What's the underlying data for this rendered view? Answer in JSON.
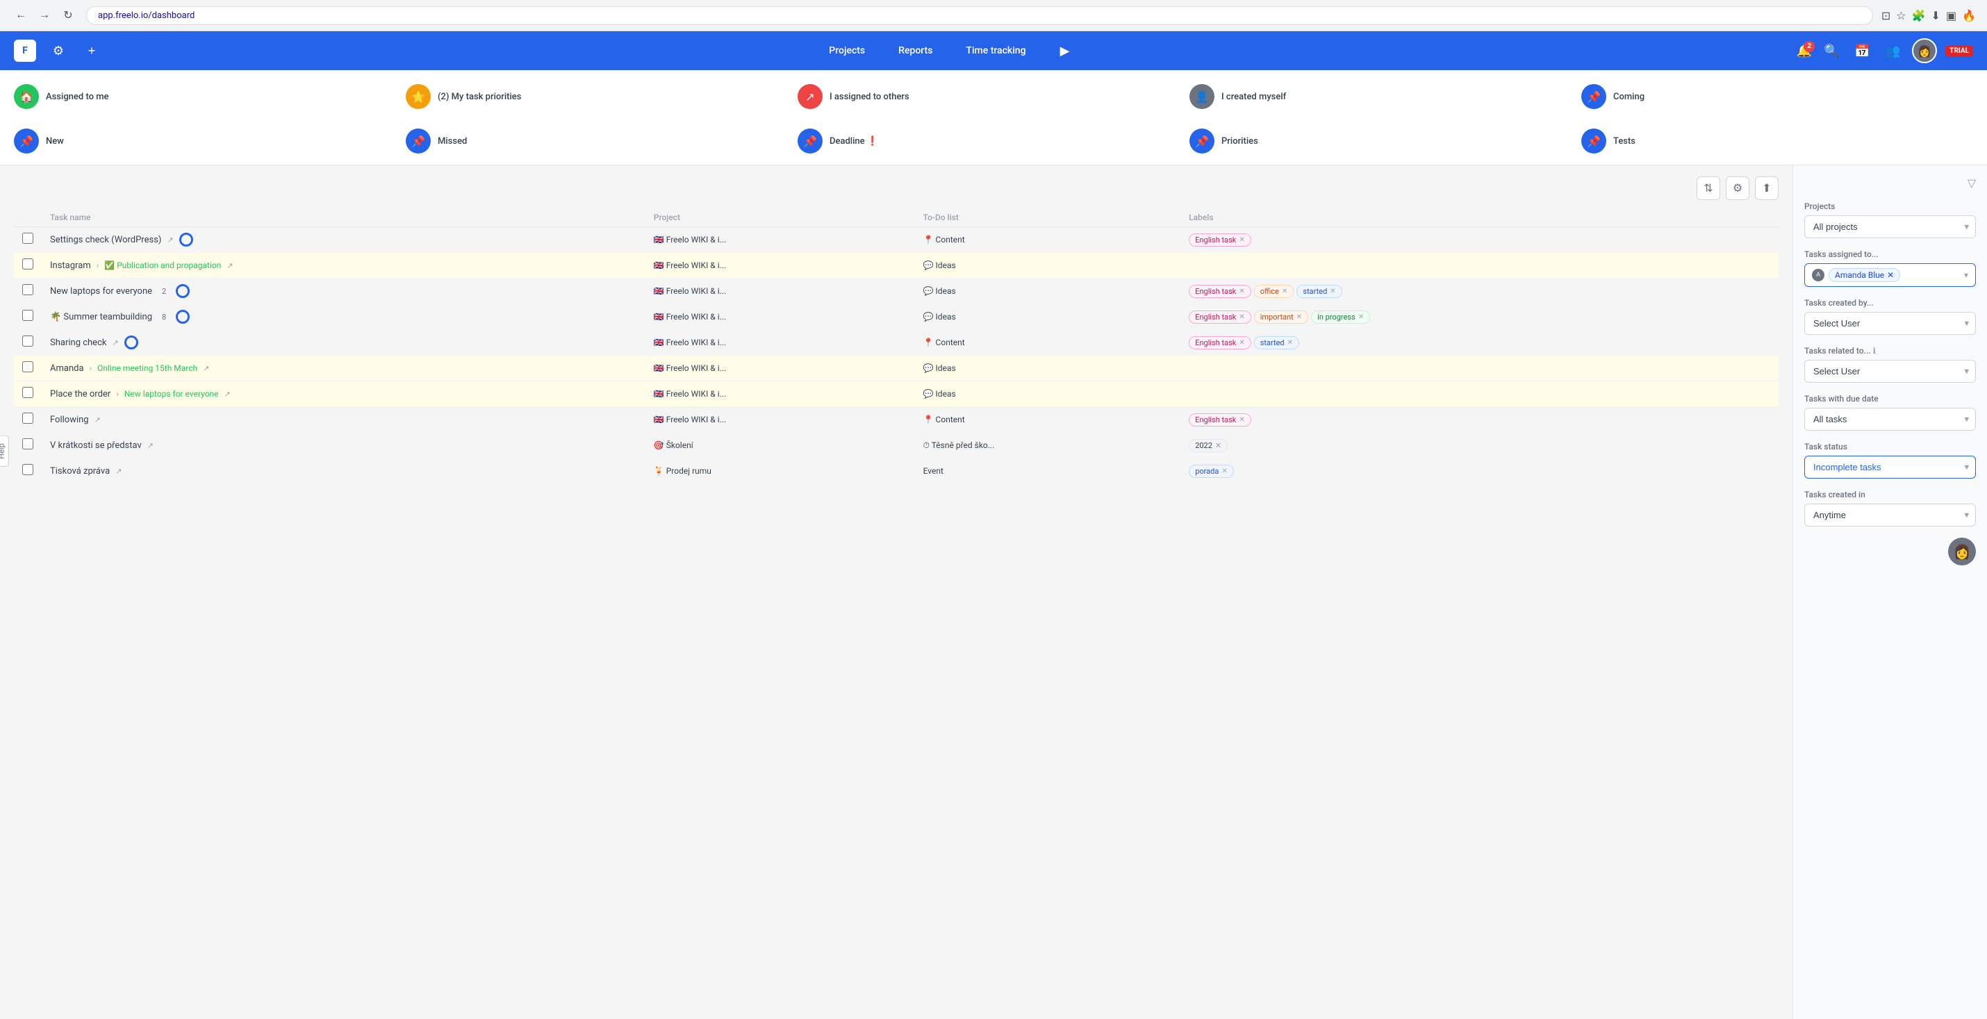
{
  "browser": {
    "url": "app.freelo.io/dashboard"
  },
  "header": {
    "logo_text": "F",
    "nav_items": [
      "Projects",
      "Reports",
      "Time tracking"
    ],
    "play_label": "▶",
    "notification_count": "2",
    "trial_label": "TRIAL"
  },
  "quick_filters": {
    "row1": [
      {
        "id": "assigned_to_me",
        "label": "Assigned to me",
        "icon": "🏠",
        "icon_bg": "#22c55e",
        "count": null
      },
      {
        "id": "my_task_priorities",
        "label": "My task priorities",
        "icon": "⭐",
        "icon_bg": "#f59e0b",
        "count": "2"
      },
      {
        "id": "assigned_to_others",
        "label": "I assigned to others",
        "icon": "↗",
        "icon_bg": "#ef4444",
        "count": null
      },
      {
        "id": "created_myself",
        "label": "I created myself",
        "icon": "👤",
        "icon_bg": "#6b7280",
        "count": null
      },
      {
        "id": "coming",
        "label": "Coming",
        "icon": "📌",
        "icon_bg": "#2563eb",
        "count": null
      }
    ],
    "row2": [
      {
        "id": "new",
        "label": "New",
        "icon": "📌",
        "icon_bg": "#2563eb"
      },
      {
        "id": "missed",
        "label": "Missed",
        "icon": "📌",
        "icon_bg": "#2563eb"
      },
      {
        "id": "deadline",
        "label": "Deadline ❗",
        "icon": "📌",
        "icon_bg": "#2563eb"
      },
      {
        "id": "priorities",
        "label": "Priorities",
        "icon": "📌",
        "icon_bg": "#2563eb"
      },
      {
        "id": "tests",
        "label": "Tests",
        "icon": "📌",
        "icon_bg": "#2563eb"
      }
    ]
  },
  "task_table": {
    "columns": [
      "Task name",
      "Project",
      "To-Do list",
      "Labels"
    ],
    "rows": [
      {
        "id": "row1",
        "name": "Settings check (WordPress)",
        "has_arrow": true,
        "has_progress": true,
        "highlighted": false,
        "project": "🇬🇧 Freelo WIKI & i...",
        "todo": "📍 Content",
        "todo_icon": "pin",
        "labels": [
          {
            "text": "English task",
            "style": "pink"
          }
        ]
      },
      {
        "id": "row2",
        "name": "Instagram",
        "subtask": "✅ Publication and propagation",
        "has_arrow": true,
        "has_progress": false,
        "highlighted": true,
        "project": "🇬🇧 Freelo WIKI & i...",
        "todo": "💬 Ideas",
        "todo_icon": "bubble",
        "labels": []
      },
      {
        "id": "row3",
        "name": "New laptops for everyone",
        "count": "2",
        "has_progress": true,
        "highlighted": false,
        "project": "🇬🇧 Freelo WIKI & i...",
        "todo": "💬 Ideas",
        "todo_icon": "bubble",
        "labels": [
          {
            "text": "English task",
            "style": "pink"
          },
          {
            "text": "office",
            "style": "orange"
          },
          {
            "text": "started",
            "style": "blue"
          }
        ]
      },
      {
        "id": "row4",
        "name": "🌴 Summer teambuilding",
        "count": "8",
        "has_progress": true,
        "highlighted": false,
        "project": "🇬🇧 Freelo WIKI & i...",
        "todo": "💬 Ideas",
        "todo_icon": "bubble",
        "labels": [
          {
            "text": "English task",
            "style": "pink"
          },
          {
            "text": "important",
            "style": "orange"
          },
          {
            "text": "in progress",
            "style": "green"
          }
        ]
      },
      {
        "id": "row5",
        "name": "Sharing check",
        "has_arrow": true,
        "has_progress": true,
        "highlighted": false,
        "project": "🇬🇧 Freelo WIKI & i...",
        "todo": "📍 Content",
        "todo_icon": "pin",
        "labels": [
          {
            "text": "English task",
            "style": "pink"
          },
          {
            "text": "started",
            "style": "blue"
          }
        ]
      },
      {
        "id": "row6",
        "name": "Amanda",
        "subtask": "Online meeting 15th March",
        "has_arrow": true,
        "has_progress": false,
        "highlighted": true,
        "project": "🇬🇧 Freelo WIKI & i...",
        "todo": "💬 Ideas",
        "todo_icon": "bubble",
        "labels": []
      },
      {
        "id": "row7",
        "name": "Place the order",
        "subtask": "New laptops for everyone",
        "has_arrow": true,
        "has_progress": false,
        "highlighted": true,
        "project": "🇬🇧 Freelo WIKI & i...",
        "todo": "💬 Ideas",
        "todo_icon": "bubble",
        "labels": []
      },
      {
        "id": "row8",
        "name": "Following",
        "has_arrow": true,
        "has_progress": false,
        "highlighted": false,
        "project": "🇬🇧 Freelo WIKI & i...",
        "todo": "📍 Content",
        "todo_icon": "pin",
        "labels": [
          {
            "text": "English task",
            "style": "pink"
          }
        ]
      },
      {
        "id": "row9",
        "name": "V krátkosti se představ",
        "has_arrow": true,
        "has_progress": false,
        "highlighted": false,
        "project": "🎯 Školení",
        "todo": "⏱ Těsně před ško...",
        "todo_icon": "clock",
        "labels": [
          {
            "text": "2022",
            "style": "year"
          }
        ]
      },
      {
        "id": "row10",
        "name": "Tisková zpráva",
        "has_arrow": true,
        "has_progress": false,
        "highlighted": false,
        "project": "🍹 Prodej rumu",
        "todo": "Event",
        "todo_icon": "none",
        "labels": [
          {
            "text": "porada",
            "style": "blue"
          }
        ]
      }
    ]
  },
  "sidebar": {
    "projects_label": "Projects",
    "projects_value": "All projects",
    "assigned_to_label": "Tasks assigned to...",
    "assigned_to_user": "Amanda Blue",
    "created_by_label": "Tasks created by...",
    "created_by_placeholder": "Select User",
    "related_to_label": "Tasks related to...",
    "related_to_placeholder": "Select User",
    "due_date_label": "Tasks with due date",
    "due_date_value": "All tasks",
    "status_label": "Task status",
    "status_value": "Incomplete tasks",
    "created_in_label": "Tasks created in",
    "created_in_value": "Anytime"
  },
  "help_tab": "Help"
}
